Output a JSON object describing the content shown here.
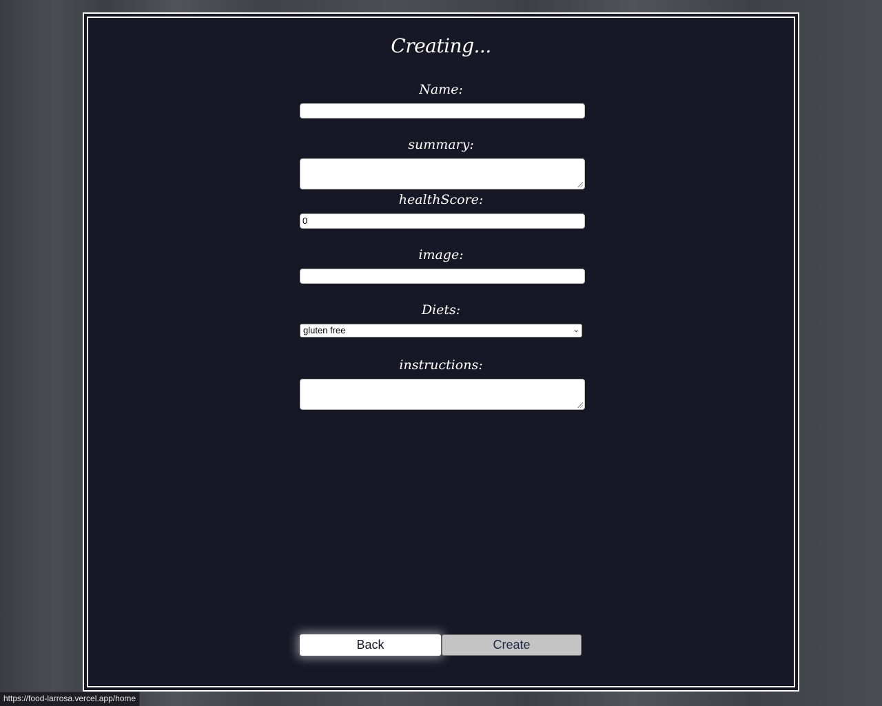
{
  "form": {
    "title": "Creating...",
    "name_label": "Name:",
    "name_value": "",
    "summary_label": "summary:",
    "summary_value": "",
    "health_label": "healthScore:",
    "health_value": "0",
    "image_label": "image:",
    "image_value": "",
    "diets_label": "Diets:",
    "diets_selected": "gluten free",
    "instructions_label": "instructions:",
    "instructions_value": "",
    "back_label": "Back",
    "create_label": "Create"
  },
  "status_bar": {
    "url": "https://food-larrosa.vercel.app/home"
  },
  "icons": {
    "select_arrow": "chevron-down-icon"
  }
}
